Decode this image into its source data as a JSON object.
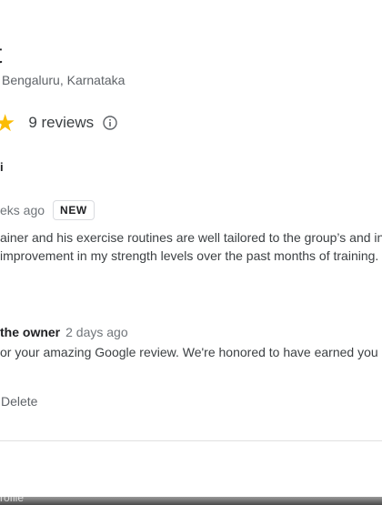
{
  "business": {
    "name_fragment": "t",
    "address": "Bengaluru, Karnataka"
  },
  "rating": {
    "star_glyph": "★",
    "reviews_count": "9 reviews",
    "star_color": "#fbbc04"
  },
  "review": {
    "reviewer_name": "i",
    "time": "eks ago",
    "badge": "NEW",
    "lines": [
      "ainer and his exercise routines are well tailored to the group’s and in",
      "improvement in my strength levels over the past months of training."
    ]
  },
  "owner_response": {
    "label": "the owner",
    "time": "2 days ago",
    "text": "or your amazing Google review. We're honored to have earned you"
  },
  "actions": {
    "delete_label": "Delete"
  },
  "bottom_bar": {
    "text": "rofile"
  },
  "icons": [
    "star-icon",
    "info-icon"
  ]
}
